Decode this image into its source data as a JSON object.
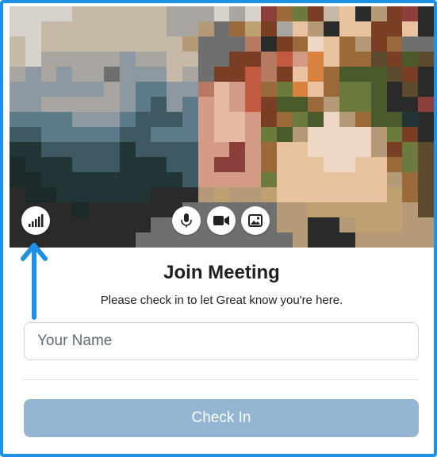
{
  "colors": {
    "accent_border": "#1e90e6",
    "arrow": "#1e90e6",
    "button_bg": "#94b6d3",
    "button_text": "#ffffff"
  },
  "preview": {
    "pixelated": true,
    "controls": {
      "signal": {
        "icon": "signal-bars-icon"
      },
      "mic": {
        "icon": "microphone-icon"
      },
      "camera": {
        "icon": "video-camera-icon"
      },
      "background": {
        "icon": "image-icon"
      }
    }
  },
  "join": {
    "title": "Join Meeting",
    "subtitle": "Please check in to let Great know you're here.",
    "name_placeholder": "Your Name",
    "name_value": "",
    "button_label": "Check In",
    "button_enabled": false
  },
  "annotation": {
    "icon": "arrow-up-icon"
  }
}
